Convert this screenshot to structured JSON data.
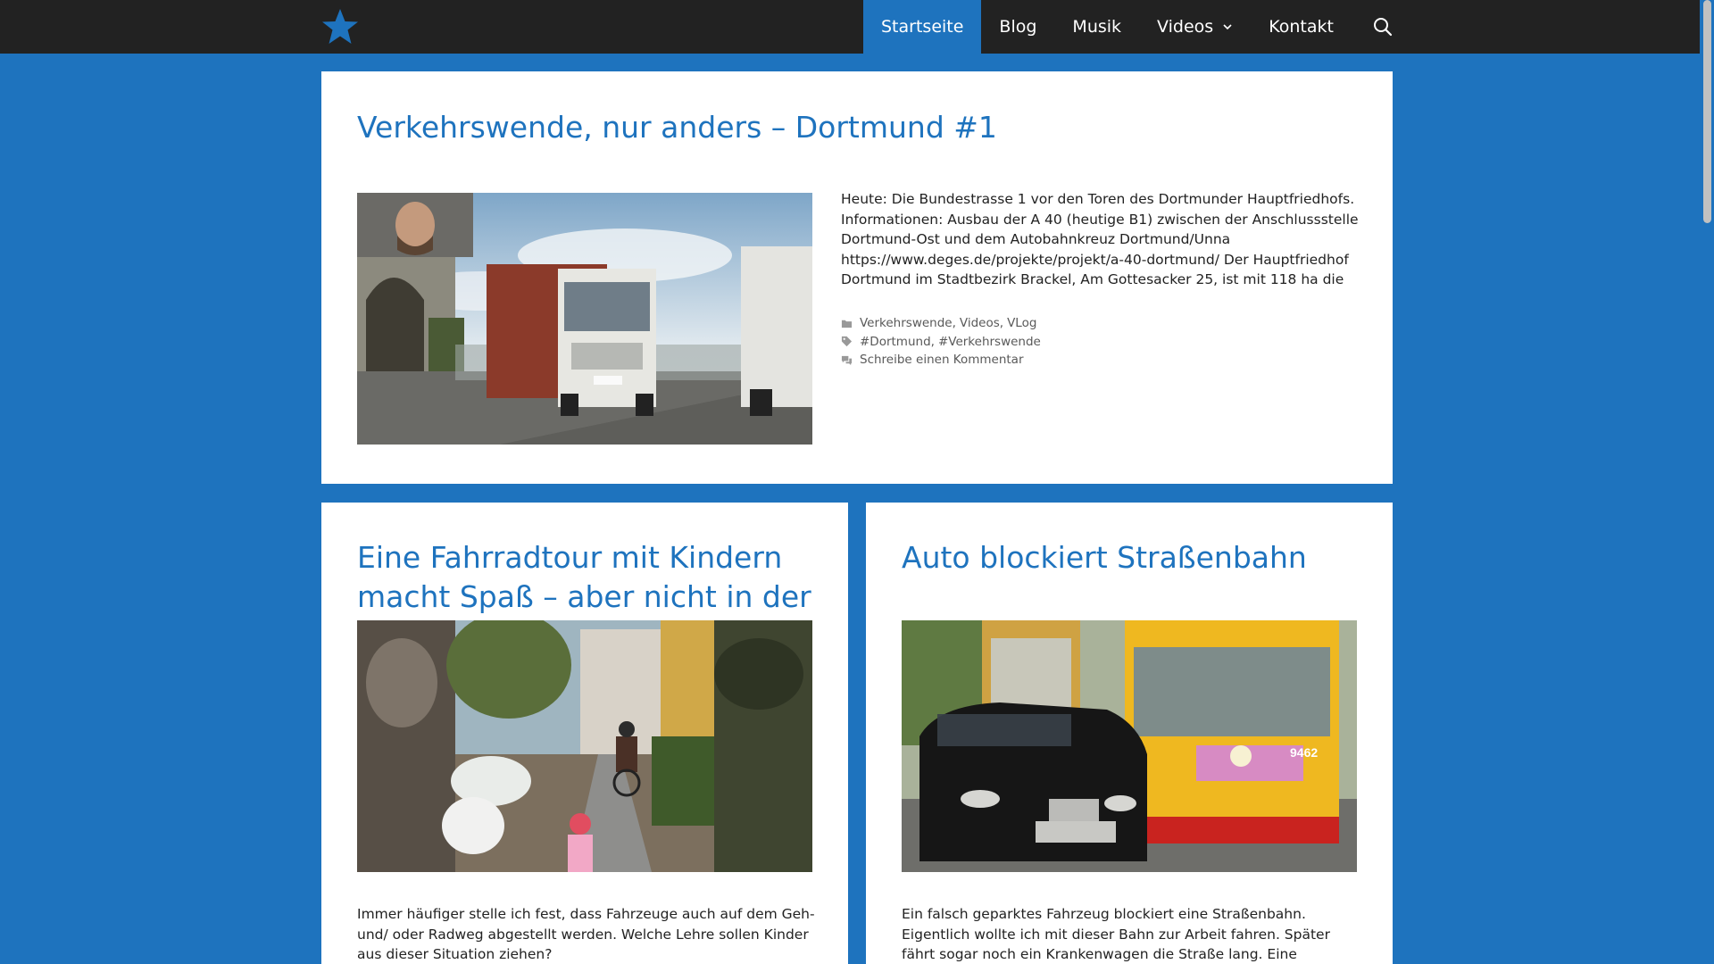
{
  "header": {
    "nav": [
      {
        "label": "Startseite"
      },
      {
        "label": "Blog"
      },
      {
        "label": "Musik"
      },
      {
        "label": "Videos"
      },
      {
        "label": "Kontakt"
      }
    ]
  },
  "posts": [
    {
      "title": "Verkehrswende, nur anders – Dortmund #1",
      "excerpt": "Heute: Die Bundestrasse 1 vor den Toren des Dortmunder Hauptfriedhofs. Informationen: Ausbau der A 40 (heutige B1) zwischen der Anschlussstelle Dortmund-Ost und dem Autobahnkreuz Dortmund/Unna https://www.deges.de/projekte/projekt/a-40-dortmund/ Der Hauptfriedhof Dortmund im Stadtbezirk Brackel, Am Gottesacker 25, ist mit 118 ha die",
      "categories": [
        "Verkehrswende",
        "Videos",
        "VLog"
      ],
      "tags": [
        "#Dortmund",
        "#Verkehrswende"
      ],
      "comments": "Schreibe einen Kommentar",
      "image": "truck-on-road-with-vlogger-inset"
    },
    {
      "title": "Eine Fahrradtour mit Kindern macht Spaß – aber nicht in der",
      "excerpt": "Immer häufiger stelle ich fest, dass Fahrzeuge auch auf dem Geh- und/ oder Radweg abgestellt werden. Welche Lehre sollen Kinder aus dieser Situation ziehen?",
      "image": "children-cycling-on-sidewalk"
    },
    {
      "title": "Auto blockiert Straßenbahn",
      "excerpt": "Ein falsch geparktes Fahrzeug blockiert eine Straßenbahn. Eigentlich wollte ich mit dieser Bahn zur Arbeit fahren. Später fährt sogar noch ein Krankenwagen die Straße lang. Eine Durchfahrt wäre kurz",
      "image": "car-blocking-tram",
      "tram_number": "9462"
    }
  ],
  "colors": {
    "accent": "#1e73be",
    "topbar": "#222222"
  }
}
